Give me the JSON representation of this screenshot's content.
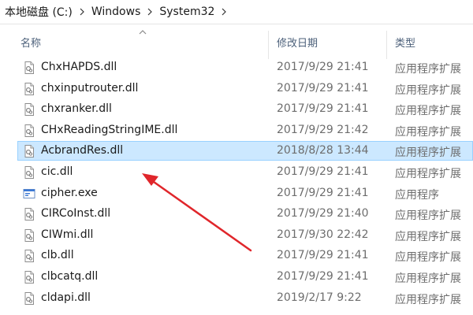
{
  "breadcrumb": {
    "items": [
      "本地磁盘 (C:)",
      "Windows",
      "System32"
    ]
  },
  "columns": {
    "name": "名称",
    "date": "修改日期",
    "type": "类型"
  },
  "files": [
    {
      "name": "ChxHAPDS.dll",
      "date": "2017/9/29 21:41",
      "type": "应用程序扩展",
      "icon": "dll-file-icon"
    },
    {
      "name": "chxinputrouter.dll",
      "date": "2017/9/29 21:41",
      "type": "应用程序扩展",
      "icon": "dll-file-icon"
    },
    {
      "name": "chxranker.dll",
      "date": "2017/9/29 21:41",
      "type": "应用程序扩展",
      "icon": "dll-file-icon"
    },
    {
      "name": "CHxReadingStringIME.dll",
      "date": "2017/9/29 21:42",
      "type": "应用程序扩展",
      "icon": "dll-file-icon"
    },
    {
      "name": "AcbrandRes.dll",
      "date": "2018/8/28 13:44",
      "type": "应用程序扩展",
      "icon": "dll-file-icon",
      "selected": true
    },
    {
      "name": "cic.dll",
      "date": "2017/9/29 21:41",
      "type": "应用程序扩展",
      "icon": "dll-file-icon"
    },
    {
      "name": "cipher.exe",
      "date": "2017/9/29 21:41",
      "type": "应用程序",
      "icon": "exe-file-icon"
    },
    {
      "name": "CIRCoInst.dll",
      "date": "2017/9/29 21:40",
      "type": "应用程序扩展",
      "icon": "dll-file-icon"
    },
    {
      "name": "CIWmi.dll",
      "date": "2017/9/30 22:42",
      "type": "应用程序扩展",
      "icon": "dll-file-icon"
    },
    {
      "name": "clb.dll",
      "date": "2017/9/29 21:41",
      "type": "应用程序扩展",
      "icon": "dll-file-icon"
    },
    {
      "name": "clbcatq.dll",
      "date": "2017/9/29 21:41",
      "type": "应用程序扩展",
      "icon": "dll-file-icon"
    },
    {
      "name": "cldapi.dll",
      "date": "2019/2/17 9:22",
      "type": "应用程序扩展",
      "icon": "dll-file-icon"
    }
  ],
  "colors": {
    "selection_bg": "#cce8ff",
    "selection_border": "#99d1ff",
    "annotation_arrow": "#e0262b"
  }
}
